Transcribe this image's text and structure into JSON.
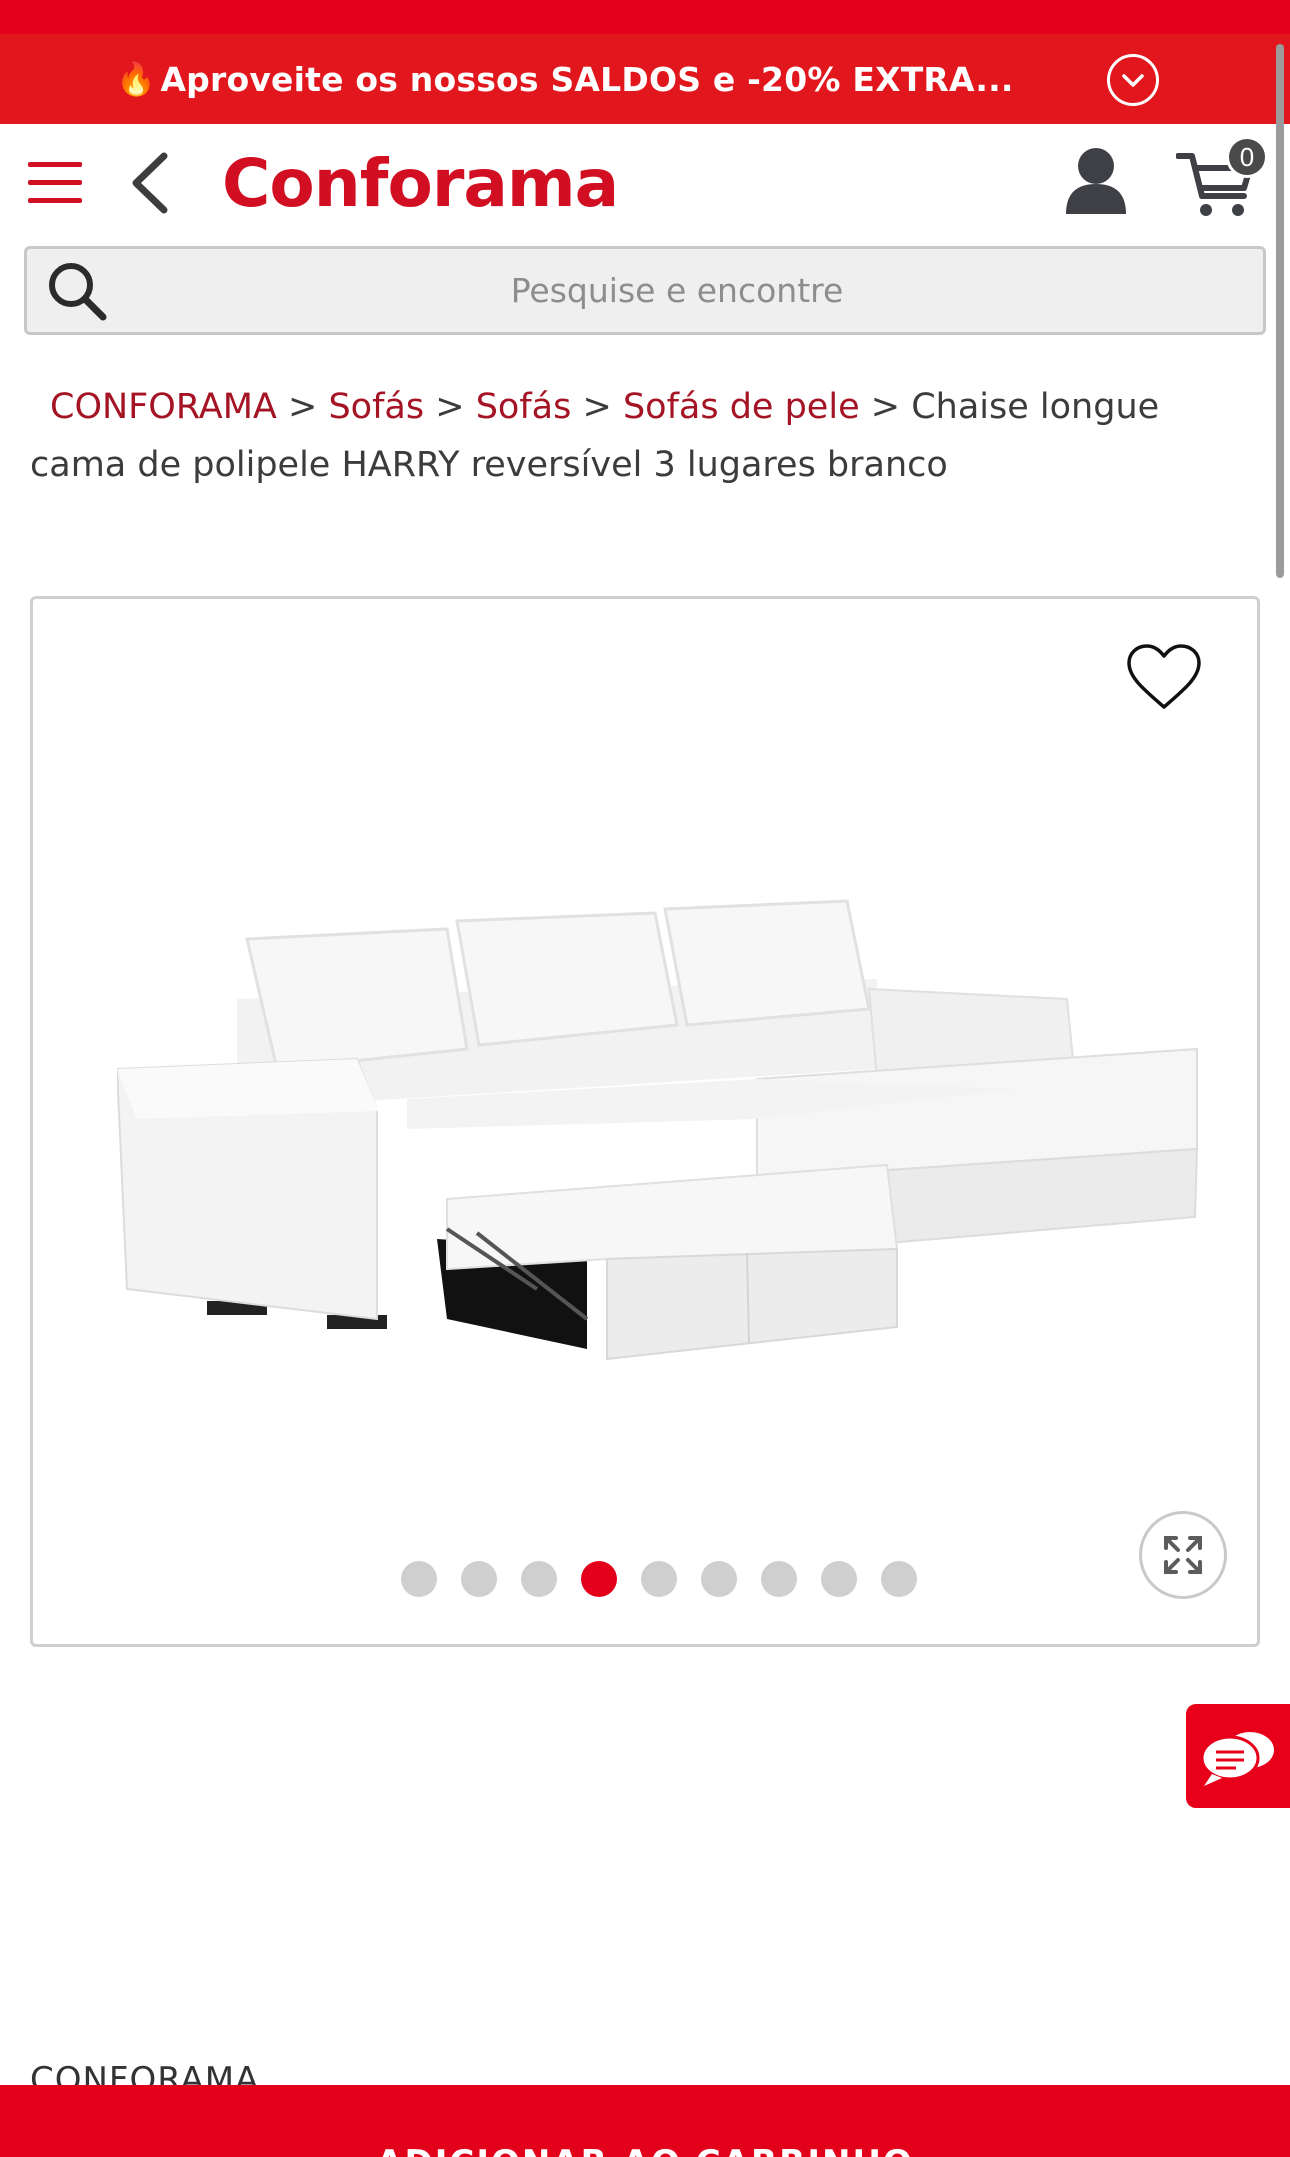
{
  "promo": {
    "text": "Aproveite os nossos SALDOS e -20% EXTRA...",
    "icon": "flame-icon",
    "toggle_icon": "chevron-down-circle-icon"
  },
  "header": {
    "logo": "Conforama",
    "cart_count": "0",
    "icons": [
      "menu-icon",
      "back-icon",
      "account-icon",
      "cart-icon"
    ]
  },
  "search": {
    "placeholder": "Pesquise e encontre"
  },
  "breadcrumb": {
    "items": [
      "CONFORAMA",
      "Sofás",
      "Sofás",
      "Sofás de pele"
    ],
    "separator": ">",
    "current": "Chaise longue cama de polipele HARRY reversível 3 lugares branco"
  },
  "gallery": {
    "total_images": 9,
    "active_index": 3,
    "icons": [
      "heart-icon",
      "expand-icon"
    ]
  },
  "footer": {
    "brand": "CONFORAMA",
    "add_to_cart": "ADICIONAR AO CARRINHO"
  },
  "colors": {
    "brand_red": "#e2001a",
    "link_red": "#a51424",
    "dot_inactive": "#cfcfcf"
  }
}
